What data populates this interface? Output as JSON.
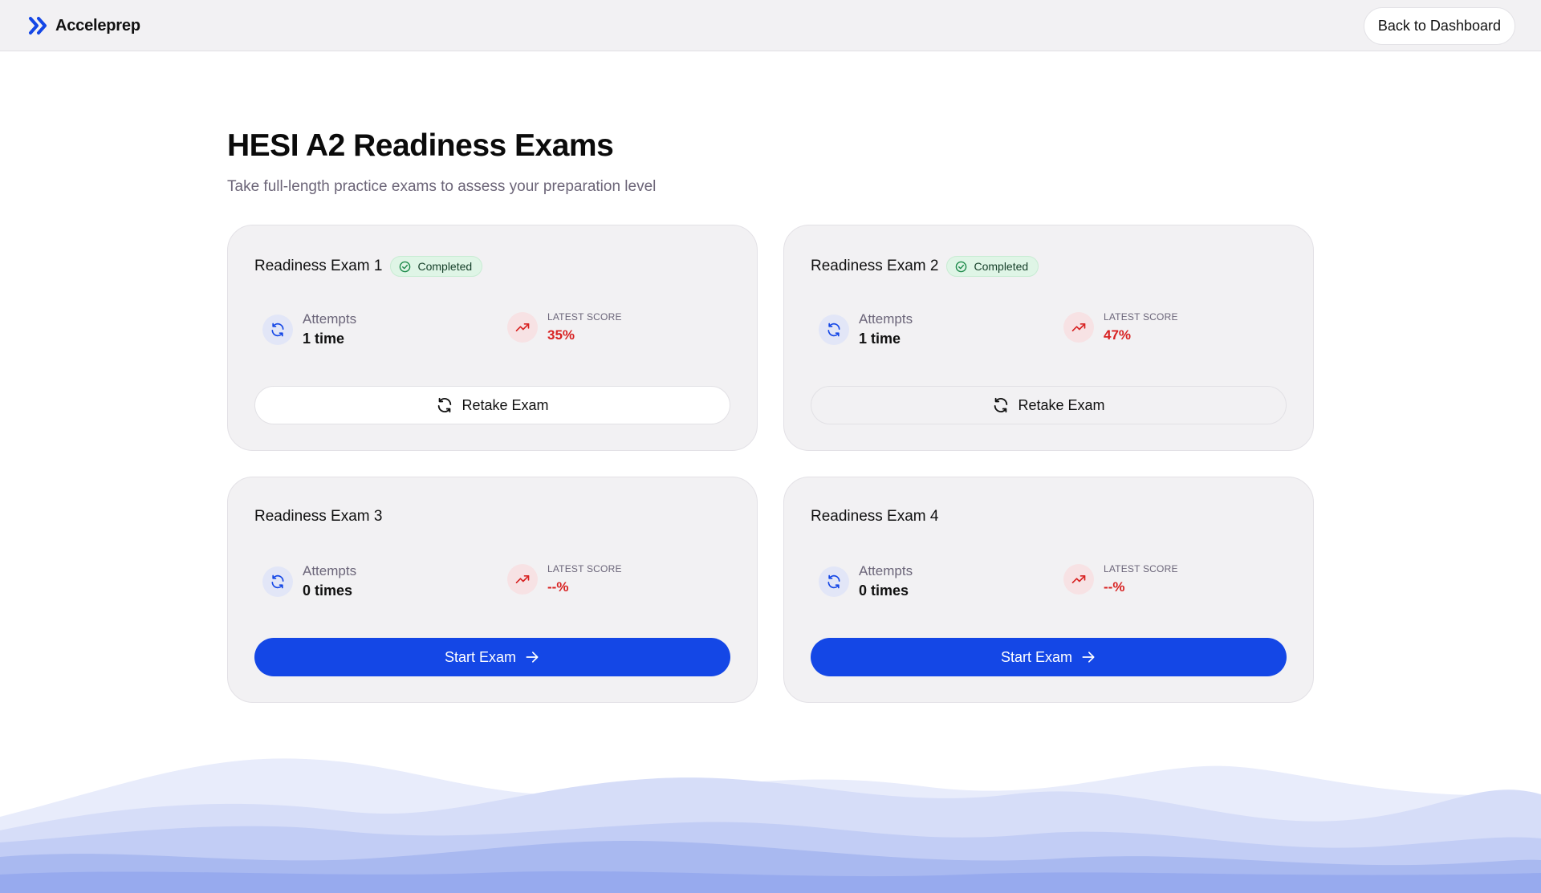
{
  "app": {
    "name": "Acceleprep",
    "back_label": "Back to Dashboard"
  },
  "page": {
    "title": "HESI A2 Readiness Exams",
    "subtitle": "Take full-length practice exams to assess your preparation level"
  },
  "labels": {
    "attempts": "Attempts",
    "latest_score": "LATEST SCORE"
  },
  "colors": {
    "accent": "#1447e6",
    "score": "#d82222",
    "completed_bg": "#dff5e6"
  },
  "exams": [
    {
      "title": "Readiness Exam 1",
      "status": "Completed",
      "attempts": "1 time",
      "score": "35%",
      "action": "Retake Exam",
      "action_icon": "refresh-icon"
    },
    {
      "title": "Readiness Exam 2",
      "status": "Completed",
      "attempts": "1 time",
      "score": "47%",
      "action": "Retake Exam",
      "action_icon": "refresh-icon"
    },
    {
      "title": "Readiness Exam 3",
      "status": "",
      "attempts": "0 times",
      "score": "--%",
      "action": "Start Exam",
      "action_icon": "arrow-right-icon"
    },
    {
      "title": "Readiness Exam 4",
      "status": "",
      "attempts": "0 times",
      "score": "--%",
      "action": "Start Exam",
      "action_icon": "arrow-right-icon"
    }
  ]
}
